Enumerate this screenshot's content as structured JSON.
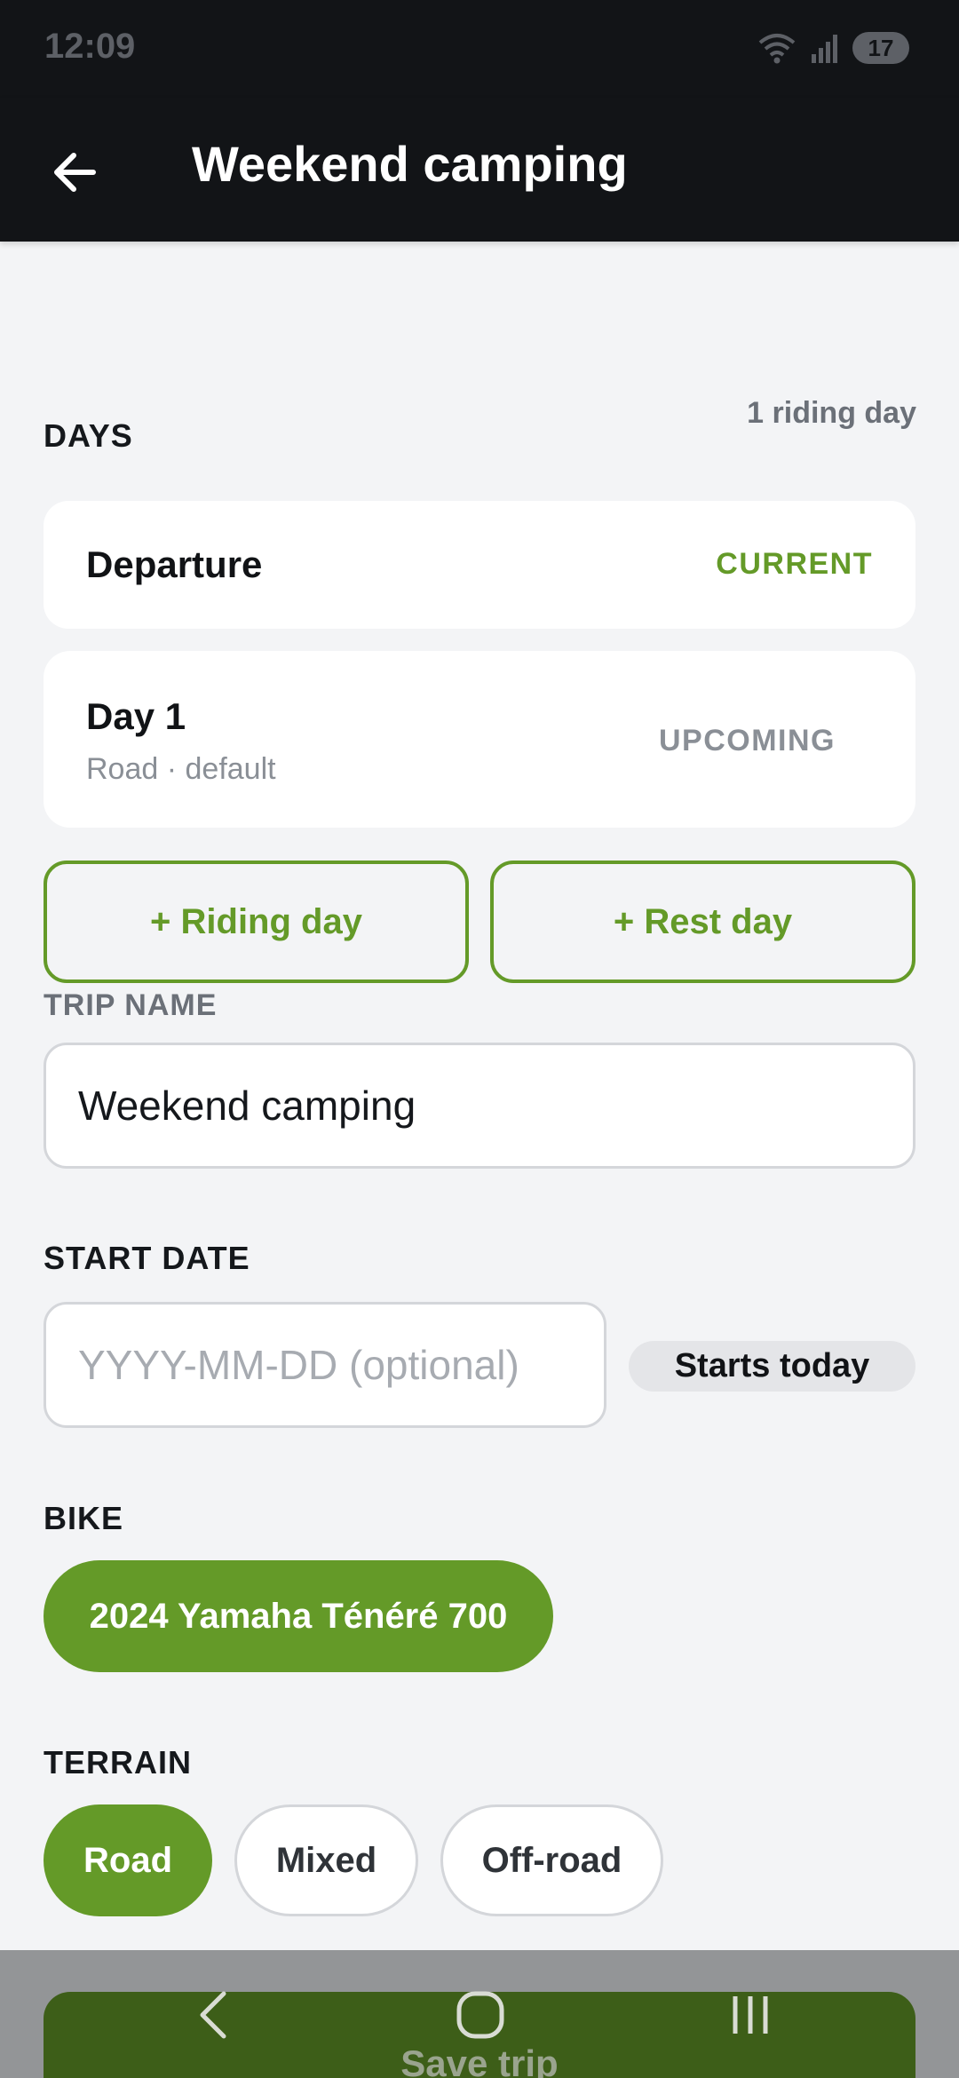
{
  "status_bar": {
    "time": "12:09",
    "battery": "17",
    "wifi_icon": "wifi-icon",
    "signal_icon": "signal-icon"
  },
  "app_bar": {
    "title": "Weekend camping",
    "back_icon": "arrow-left-icon"
  },
  "days": {
    "label": "DAYS",
    "count": "1 riding day",
    "items": [
      {
        "title": "Departure",
        "subtitle": "",
        "status": "CURRENT"
      },
      {
        "title": "Day 1",
        "subtitle": "Road · default",
        "status": "UPCOMING"
      }
    ],
    "add_riding_label": "+ Riding day",
    "add_rest_label": "+ Rest day"
  },
  "trip_name": {
    "label": "TRIP NAME",
    "value": "Weekend camping"
  },
  "start_date": {
    "label": "START DATE",
    "placeholder": "YYYY-MM-DD (optional)",
    "value": "",
    "hint": "Starts today"
  },
  "bike": {
    "label": "BIKE",
    "selected": "2024 Yamaha Ténéré 700"
  },
  "terrain": {
    "label": "TERRAIN",
    "options": [
      "Road",
      "Mixed",
      "Off-road"
    ],
    "selected": "Road"
  },
  "save_button": {
    "label": "Save trip"
  },
  "colors": {
    "accent": "#649a28",
    "dark_bar": "#121417",
    "background": "#f3f4f6",
    "muted": "#8a8f96"
  }
}
